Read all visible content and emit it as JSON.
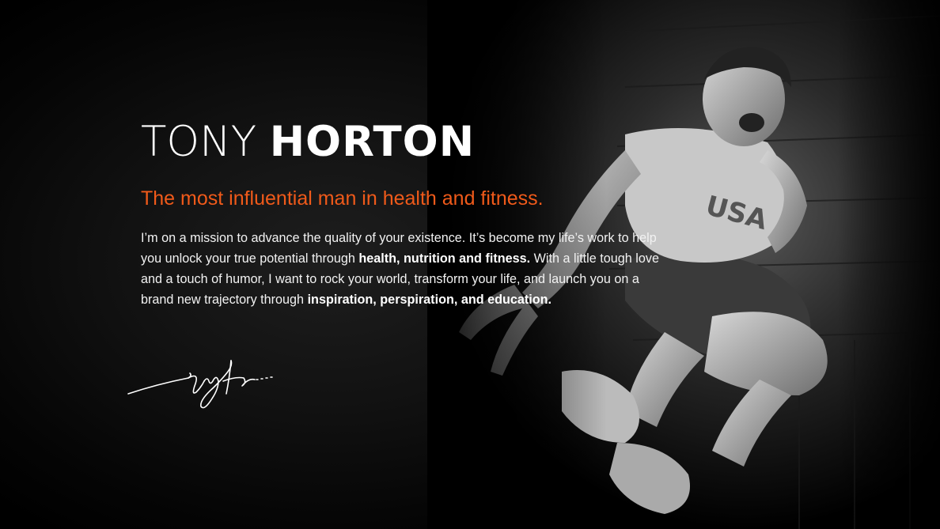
{
  "hero": {
    "title_first": "TONY",
    "title_last": "HORTON",
    "tagline": "The most influential man in health and fitness.",
    "bio": {
      "part1": "I’m on a mission to advance the quality of your existence. It’s become my life’s work to help you unlock your true potential through ",
      "bold1": "health, nutrition and fitness.",
      "part2": " With a little tough love and a touch of humor, I want to rock your world, transform your life, and launch you on a brand new trajectory through ",
      "bold2": "inspiration, perspiration, and education."
    },
    "signature_icon": "signature-icon",
    "photo_icon": "jumping-man-photo-icon"
  },
  "colors": {
    "background": "#000000",
    "accent": "#f05a1a",
    "text": "#ffffff"
  }
}
